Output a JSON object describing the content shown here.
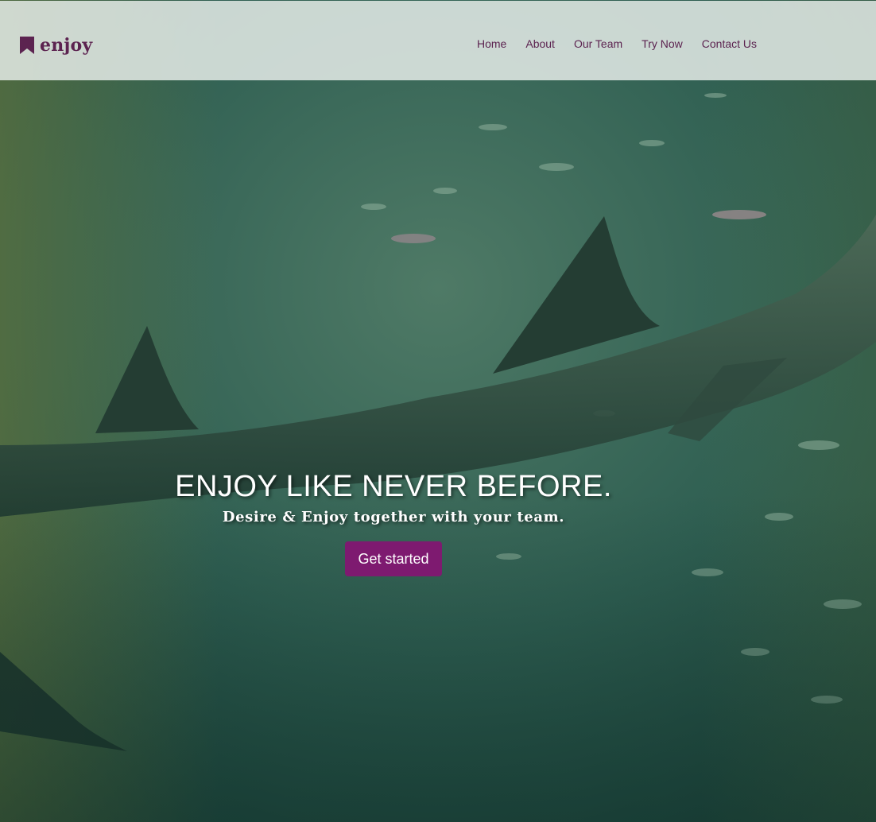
{
  "brand": {
    "name": "enjoy",
    "icon": "bookmark-icon",
    "color": "#5c2350"
  },
  "nav": {
    "items": [
      {
        "label": "Home"
      },
      {
        "label": "About"
      },
      {
        "label": "Our Team"
      },
      {
        "label": "Try Now"
      },
      {
        "label": "Contact Us"
      }
    ]
  },
  "hero": {
    "title": "ENJOY LIKE NEVER BEFORE.",
    "subtitle": "Desire & Enjoy together with your team.",
    "cta_label": "Get started",
    "cta_color": "#7e1a70",
    "background": "underwater-shark-image"
  }
}
